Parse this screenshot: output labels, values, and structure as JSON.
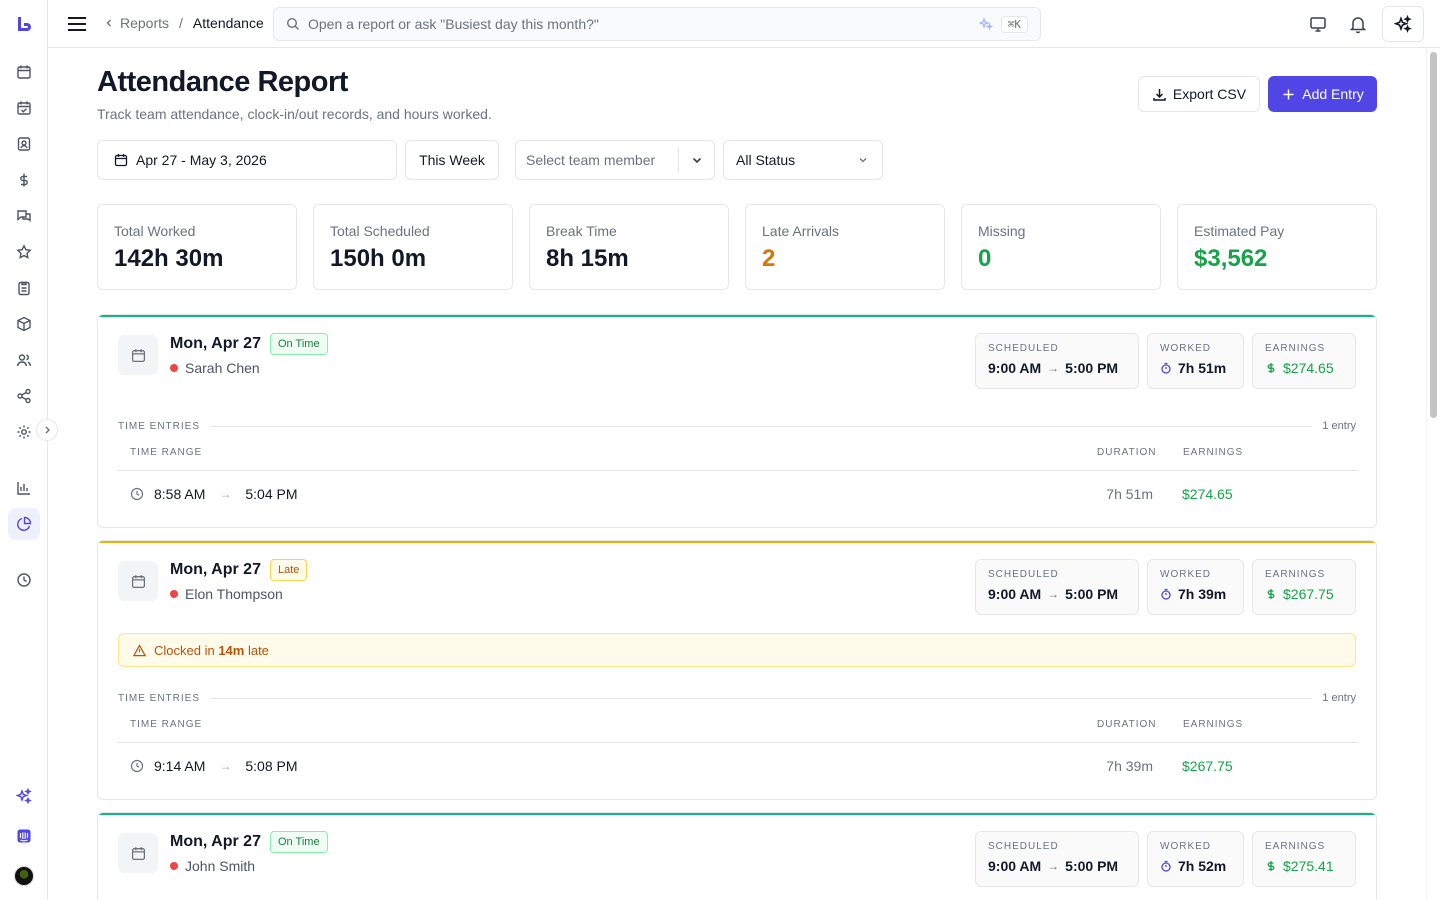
{
  "topbar": {
    "breadcrumb_parent": "Reports",
    "breadcrumb_separator": "/",
    "breadcrumb_current": "Attendance",
    "search_placeholder": "Open a report or ask \"Busiest day this month?\"",
    "search_shortcut": "⌘K"
  },
  "page": {
    "title": "Attendance Report",
    "subtitle": "Track team attendance, clock-in/out records, and hours worked.",
    "export_label": "Export CSV",
    "add_label": "Add Entry"
  },
  "filters": {
    "date_range": "Apr 27 - May 3, 2026",
    "week_label": "This Week",
    "member_placeholder": "Select team member",
    "status_value": "All Status"
  },
  "stats": [
    {
      "label": "Total Worked",
      "value": "142h 30m",
      "color": "#111827"
    },
    {
      "label": "Total Scheduled",
      "value": "150h 0m",
      "color": "#111827"
    },
    {
      "label": "Break Time",
      "value": "8h 15m",
      "color": "#111827"
    },
    {
      "label": "Late Arrivals",
      "value": "2",
      "color": "#d97706"
    },
    {
      "label": "Missing",
      "value": "0",
      "color": "#16a34a"
    },
    {
      "label": "Estimated Pay",
      "value": "$3,562",
      "color": "#16a34a"
    }
  ],
  "labels": {
    "scheduled": "SCHEDULED",
    "worked": "WORKED",
    "earnings": "EARNINGS",
    "time_entries": "TIME ENTRIES",
    "time_range": "TIME RANGE",
    "duration": "DURATION",
    "earnings_col": "EARNINGS"
  },
  "cards": [
    {
      "date": "Mon, Apr 27",
      "status": "On Time",
      "accent": "#10b981",
      "person": "Sarah Chen",
      "sched_start": "9:00 AM",
      "sched_end": "5:00 PM",
      "worked": "7h 51m",
      "earnings": "$274.65",
      "entry_count": "1 entry",
      "entries": [
        {
          "start": "8:58 AM",
          "end": "5:04 PM",
          "duration": "7h 51m",
          "earnings": "$274.65"
        }
      ]
    },
    {
      "date": "Mon, Apr 27",
      "status": "Late",
      "accent": "#eab308",
      "person": "Elon Thompson",
      "warning_prefix": "Clocked in ",
      "warning_value": "14m",
      "warning_suffix": " late",
      "sched_start": "9:00 AM",
      "sched_end": "5:00 PM",
      "worked": "7h 39m",
      "earnings": "$267.75",
      "entry_count": "1 entry",
      "entries": [
        {
          "start": "9:14 AM",
          "end": "5:08 PM",
          "duration": "7h 39m",
          "earnings": "$267.75"
        }
      ]
    },
    {
      "date": "Mon, Apr 27",
      "status": "On Time",
      "accent": "#10b981",
      "person": "John Smith",
      "sched_start": "9:00 AM",
      "sched_end": "5:00 PM",
      "worked": "7h 52m",
      "earnings": "$275.41"
    }
  ],
  "colors": {
    "brand": "#4f46e5",
    "green": "#16a34a",
    "amber": "#d97706"
  }
}
